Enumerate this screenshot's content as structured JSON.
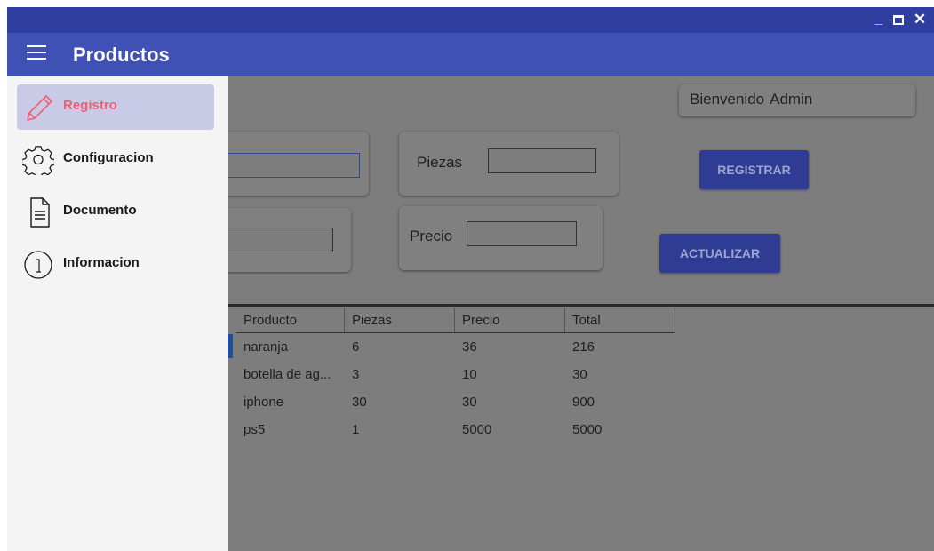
{
  "window": {
    "minimize": "_",
    "close": "✕"
  },
  "appbar": {
    "title": "Productos"
  },
  "drawer": {
    "items": [
      {
        "label": "Registro",
        "icon": "pencil-icon",
        "active": true
      },
      {
        "label": "Configuracion",
        "icon": "gear-icon",
        "active": false
      },
      {
        "label": "Documento",
        "icon": "document-icon",
        "active": false
      },
      {
        "label": "Informacion",
        "icon": "info-icon",
        "active": false
      }
    ],
    "active_color": "#f06074"
  },
  "form": {
    "piezas_label": "Piezas",
    "precio_label": "Precio",
    "registrar_label": "REGISTRAR",
    "actualizar_label": "ACTUALIZAR"
  },
  "welcome": {
    "greeting": "Bienvenido",
    "user": "Admin"
  },
  "table": {
    "columns": [
      "Producto",
      "Piezas",
      "Precio",
      "Total"
    ],
    "rows": [
      [
        "naranja",
        "6",
        "36",
        "216"
      ],
      [
        "botella de ag...",
        "3",
        "10",
        "30"
      ],
      [
        "iphone",
        "30",
        "30",
        "900"
      ],
      [
        "ps5",
        "1",
        "5000",
        "5000"
      ]
    ]
  },
  "colors": {
    "titlebar": "#2f3e9f",
    "appbar": "#3f51b5",
    "button": "#2e3d93"
  }
}
